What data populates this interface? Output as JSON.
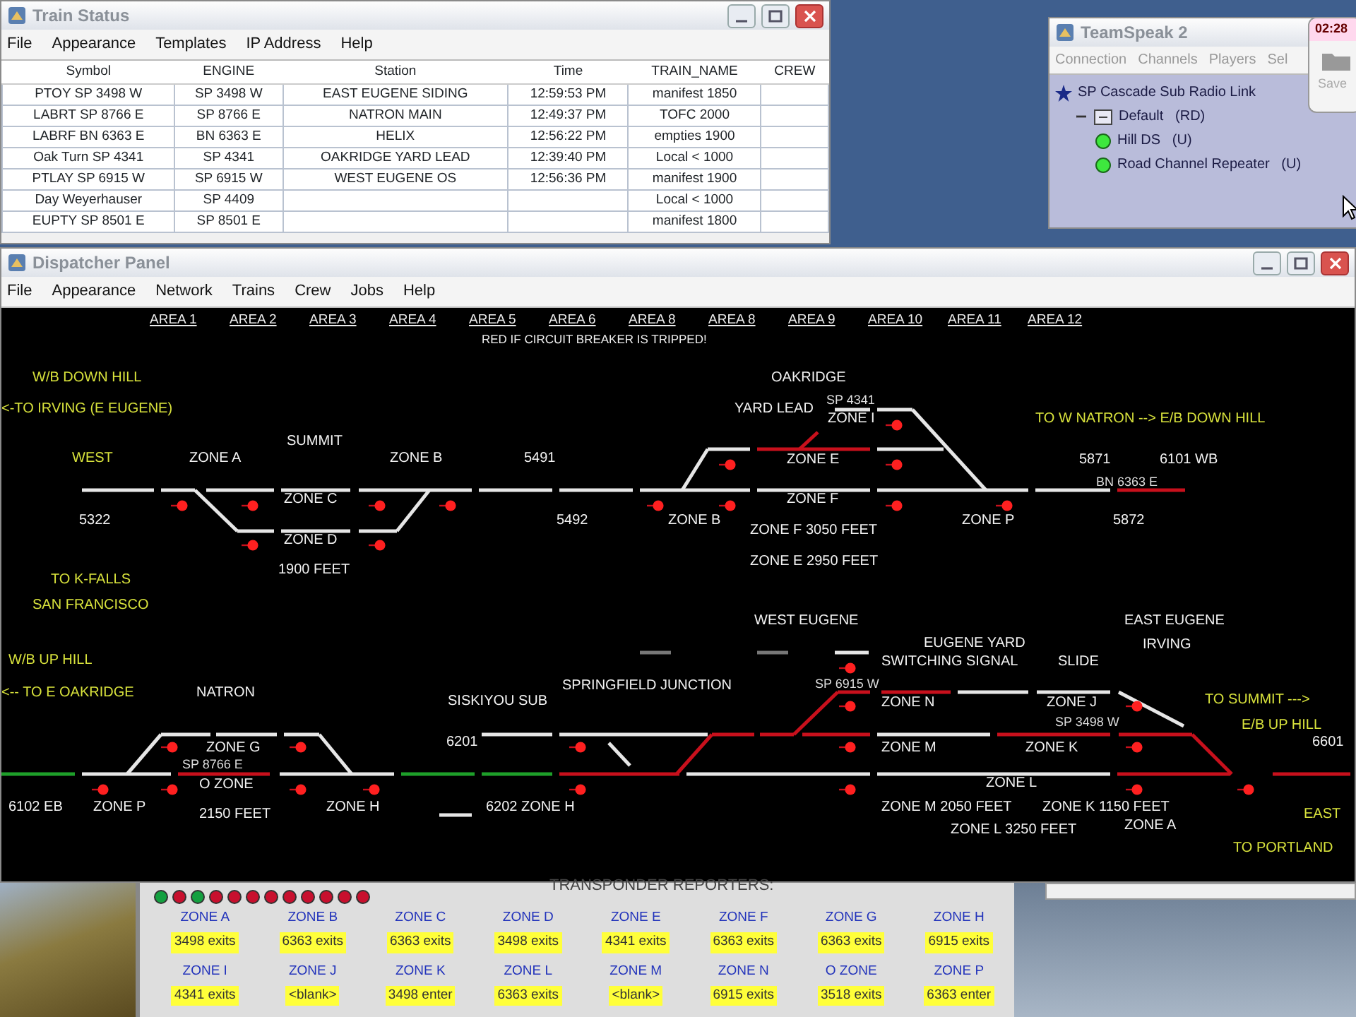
{
  "train_status": {
    "title": "Train Status",
    "menu": [
      "File",
      "Appearance",
      "Templates",
      "IP Address",
      "Help"
    ],
    "columns": [
      "Symbol",
      "ENGINE",
      "Station",
      "Time",
      "TRAIN_NAME",
      "CREW"
    ],
    "rows": [
      [
        "PTOY SP 3498 W",
        "SP 3498 W",
        "EAST EUGENE SIDING",
        "12:59:53 PM",
        "manifest 1850",
        ""
      ],
      [
        "LABRT SP 8766 E",
        "SP 8766 E",
        "NATRON MAIN",
        "12:49:37 PM",
        "TOFC 2000",
        ""
      ],
      [
        "LABRF BN 6363 E",
        "BN 6363 E",
        "HELIX",
        "12:56:22 PM",
        "empties 1900",
        ""
      ],
      [
        "Oak Turn SP 4341",
        "SP 4341",
        "OAKRIDGE YARD LEAD",
        "12:39:40 PM",
        "Local < 1000",
        ""
      ],
      [
        "PTLAY SP 6915 W",
        "SP 6915 W",
        "WEST EUGENE OS",
        "12:56:36 PM",
        "manifest 1900",
        ""
      ],
      [
        "Day Weyerhauser",
        "SP 4409",
        "",
        "",
        "Local < 1000",
        ""
      ],
      [
        "EUPTY SP 8501 E",
        "SP 8501 E",
        "",
        "",
        "manifest 1800",
        ""
      ]
    ]
  },
  "teamspeak": {
    "title": "TeamSpeak 2",
    "menu": [
      "Connection",
      "Channels",
      "Players",
      "Sel"
    ],
    "tree": [
      {
        "label": "SP Cascade Sub Radio Link",
        "children": [
          {
            "label": "Default   (RD)",
            "expanded": true,
            "children": [
              {
                "label": "Hill DS   (U)"
              },
              {
                "label": "Road Channel Repeater   (U)"
              }
            ]
          }
        ]
      }
    ]
  },
  "clock_widget": {
    "time": "02:28",
    "label": "Save"
  },
  "dispatcher": {
    "title": "Dispatcher Panel",
    "menu": [
      "File",
      "Appearance",
      "Network",
      "Trains",
      "Crew",
      "Jobs",
      "Help"
    ],
    "areas": [
      "AREA 1",
      "AREA 2",
      "AREA 3",
      "AREA 4",
      "AREA 5",
      "AREA 6",
      "AREA 8",
      "AREA 8",
      "AREA 9",
      "AREA 10",
      "AREA 11",
      "AREA 12"
    ],
    "notice": "RED IF CIRCUIT BREAKER IS TRIPPED!",
    "labels": [
      {
        "text": "W/B DOWN HILL",
        "kind": "direction"
      },
      {
        "text": "OAKRIDGE",
        "kind": "name"
      },
      {
        "text": "SP 4341",
        "kind": "engine"
      },
      {
        "text": "<-TO IRVING (E EUGENE)",
        "kind": "direction"
      },
      {
        "text": "YARD LEAD",
        "kind": "name"
      },
      {
        "text": "ZONE I",
        "kind": "name"
      },
      {
        "text": "TO W NATRON --> E/B DOWN HILL",
        "kind": "direction"
      },
      {
        "text": "SUMMIT",
        "kind": "name"
      },
      {
        "text": "WEST",
        "kind": "direction"
      },
      {
        "text": "ZONE A",
        "kind": "name"
      },
      {
        "text": "ZONE B",
        "kind": "name"
      },
      {
        "text": "5491",
        "kind": "name"
      },
      {
        "text": "ZONE E",
        "kind": "name"
      },
      {
        "text": "5871",
        "kind": "name"
      },
      {
        "text": "6101 WB",
        "kind": "name"
      },
      {
        "text": "BN 6363 E",
        "kind": "engine"
      },
      {
        "text": "ZONE C",
        "kind": "name"
      },
      {
        "text": "ZONE F",
        "kind": "name"
      },
      {
        "text": "5322",
        "kind": "name"
      },
      {
        "text": "5492",
        "kind": "name"
      },
      {
        "text": "ZONE B",
        "kind": "name"
      },
      {
        "text": "ZONE P",
        "kind": "name"
      },
      {
        "text": "5872",
        "kind": "name"
      },
      {
        "text": "ZONE F 3050 FEET",
        "kind": "name"
      },
      {
        "text": "ZONE D",
        "kind": "name"
      },
      {
        "text": "ZONE E 2950 FEET",
        "kind": "name"
      },
      {
        "text": "1900 FEET",
        "kind": "name"
      },
      {
        "text": "TO K-FALLS",
        "kind": "direction"
      },
      {
        "text": "SAN FRANCISCO",
        "kind": "direction"
      },
      {
        "text": "WEST EUGENE",
        "kind": "name"
      },
      {
        "text": "EAST EUGENE",
        "kind": "name"
      },
      {
        "text": "EUGENE YARD",
        "kind": "name"
      },
      {
        "text": "IRVING",
        "kind": "name"
      },
      {
        "text": "W/B UP HILL",
        "kind": "direction"
      },
      {
        "text": "SWITCHING SIGNAL",
        "kind": "name"
      },
      {
        "text": "SLIDE",
        "kind": "name"
      },
      {
        "text": "SP 6915 W",
        "kind": "engine"
      },
      {
        "text": "SPRINGFIELD JUNCTION",
        "kind": "name"
      },
      {
        "text": "<-- TO E OAKRIDGE",
        "kind": "direction"
      },
      {
        "text": "NATRON",
        "kind": "name"
      },
      {
        "text": "SISKIYOU SUB",
        "kind": "name"
      },
      {
        "text": "ZONE N",
        "kind": "name"
      },
      {
        "text": "ZONE J",
        "kind": "name"
      },
      {
        "text": "TO SUMMIT --->",
        "kind": "direction"
      },
      {
        "text": "SP 3498 W",
        "kind": "engine"
      },
      {
        "text": "E/B UP HILL",
        "kind": "direction"
      },
      {
        "text": "ZONE G",
        "kind": "name"
      },
      {
        "text": "6201",
        "kind": "name"
      },
      {
        "text": "ZONE M",
        "kind": "name"
      },
      {
        "text": "ZONE K",
        "kind": "name"
      },
      {
        "text": "6601",
        "kind": "name"
      },
      {
        "text": "SP 8766 E",
        "kind": "engine"
      },
      {
        "text": "O ZONE",
        "kind": "name"
      },
      {
        "text": "ZONE L",
        "kind": "name"
      },
      {
        "text": "6102 EB",
        "kind": "name"
      },
      {
        "text": "ZONE P",
        "kind": "name"
      },
      {
        "text": "ZONE H",
        "kind": "name"
      },
      {
        "text": "6202 ZONE H",
        "kind": "name"
      },
      {
        "text": "ZONE M 2050 FEET",
        "kind": "name"
      },
      {
        "text": "ZONE K 1150 FEET",
        "kind": "name"
      },
      {
        "text": "EAST",
        "kind": "direction"
      },
      {
        "text": "2150 FEET",
        "kind": "name"
      },
      {
        "text": "ZONE L 3250 FEET",
        "kind": "name"
      },
      {
        "text": "ZONE A",
        "kind": "name"
      },
      {
        "text": "TO PORTLAND",
        "kind": "direction"
      }
    ]
  },
  "transponder": {
    "title": "TRANSPONDER REPORTERS:",
    "lamps": [
      {
        "color": "#14a040"
      },
      {
        "color": "#c8102e"
      },
      {
        "color": "#14a040"
      },
      {
        "color": "#c8102e"
      },
      {
        "color": "#c8102e"
      },
      {
        "color": "#c8102e"
      },
      {
        "color": "#c8102e"
      },
      {
        "color": "#c8102e"
      },
      {
        "color": "#c8102e"
      },
      {
        "color": "#c8102e"
      },
      {
        "color": "#c8102e"
      },
      {
        "color": "#c8102e"
      }
    ],
    "reporters": [
      {
        "zone": "ZONE A",
        "reading": "3498 exits"
      },
      {
        "zone": "ZONE B",
        "reading": "6363 exits"
      },
      {
        "zone": "ZONE C",
        "reading": "6363 exits"
      },
      {
        "zone": "ZONE D",
        "reading": "3498 exits"
      },
      {
        "zone": "ZONE E",
        "reading": "4341 exits"
      },
      {
        "zone": "ZONE F",
        "reading": "6363 exits"
      },
      {
        "zone": "ZONE G",
        "reading": "6363 exits"
      },
      {
        "zone": "ZONE H",
        "reading": "6915 exits"
      },
      {
        "zone": "ZONE I",
        "reading": "4341 exits"
      },
      {
        "zone": "ZONE J",
        "reading": "<blank>"
      },
      {
        "zone": "ZONE K",
        "reading": "3498 enter"
      },
      {
        "zone": "ZONE L",
        "reading": "6363 exits"
      },
      {
        "zone": "ZONE M",
        "reading": "<blank>"
      },
      {
        "zone": "ZONE N",
        "reading": "6915 exits"
      },
      {
        "zone": "O ZONE",
        "reading": "3518 exits"
      },
      {
        "zone": "ZONE P",
        "reading": "6363 enter"
      }
    ]
  }
}
